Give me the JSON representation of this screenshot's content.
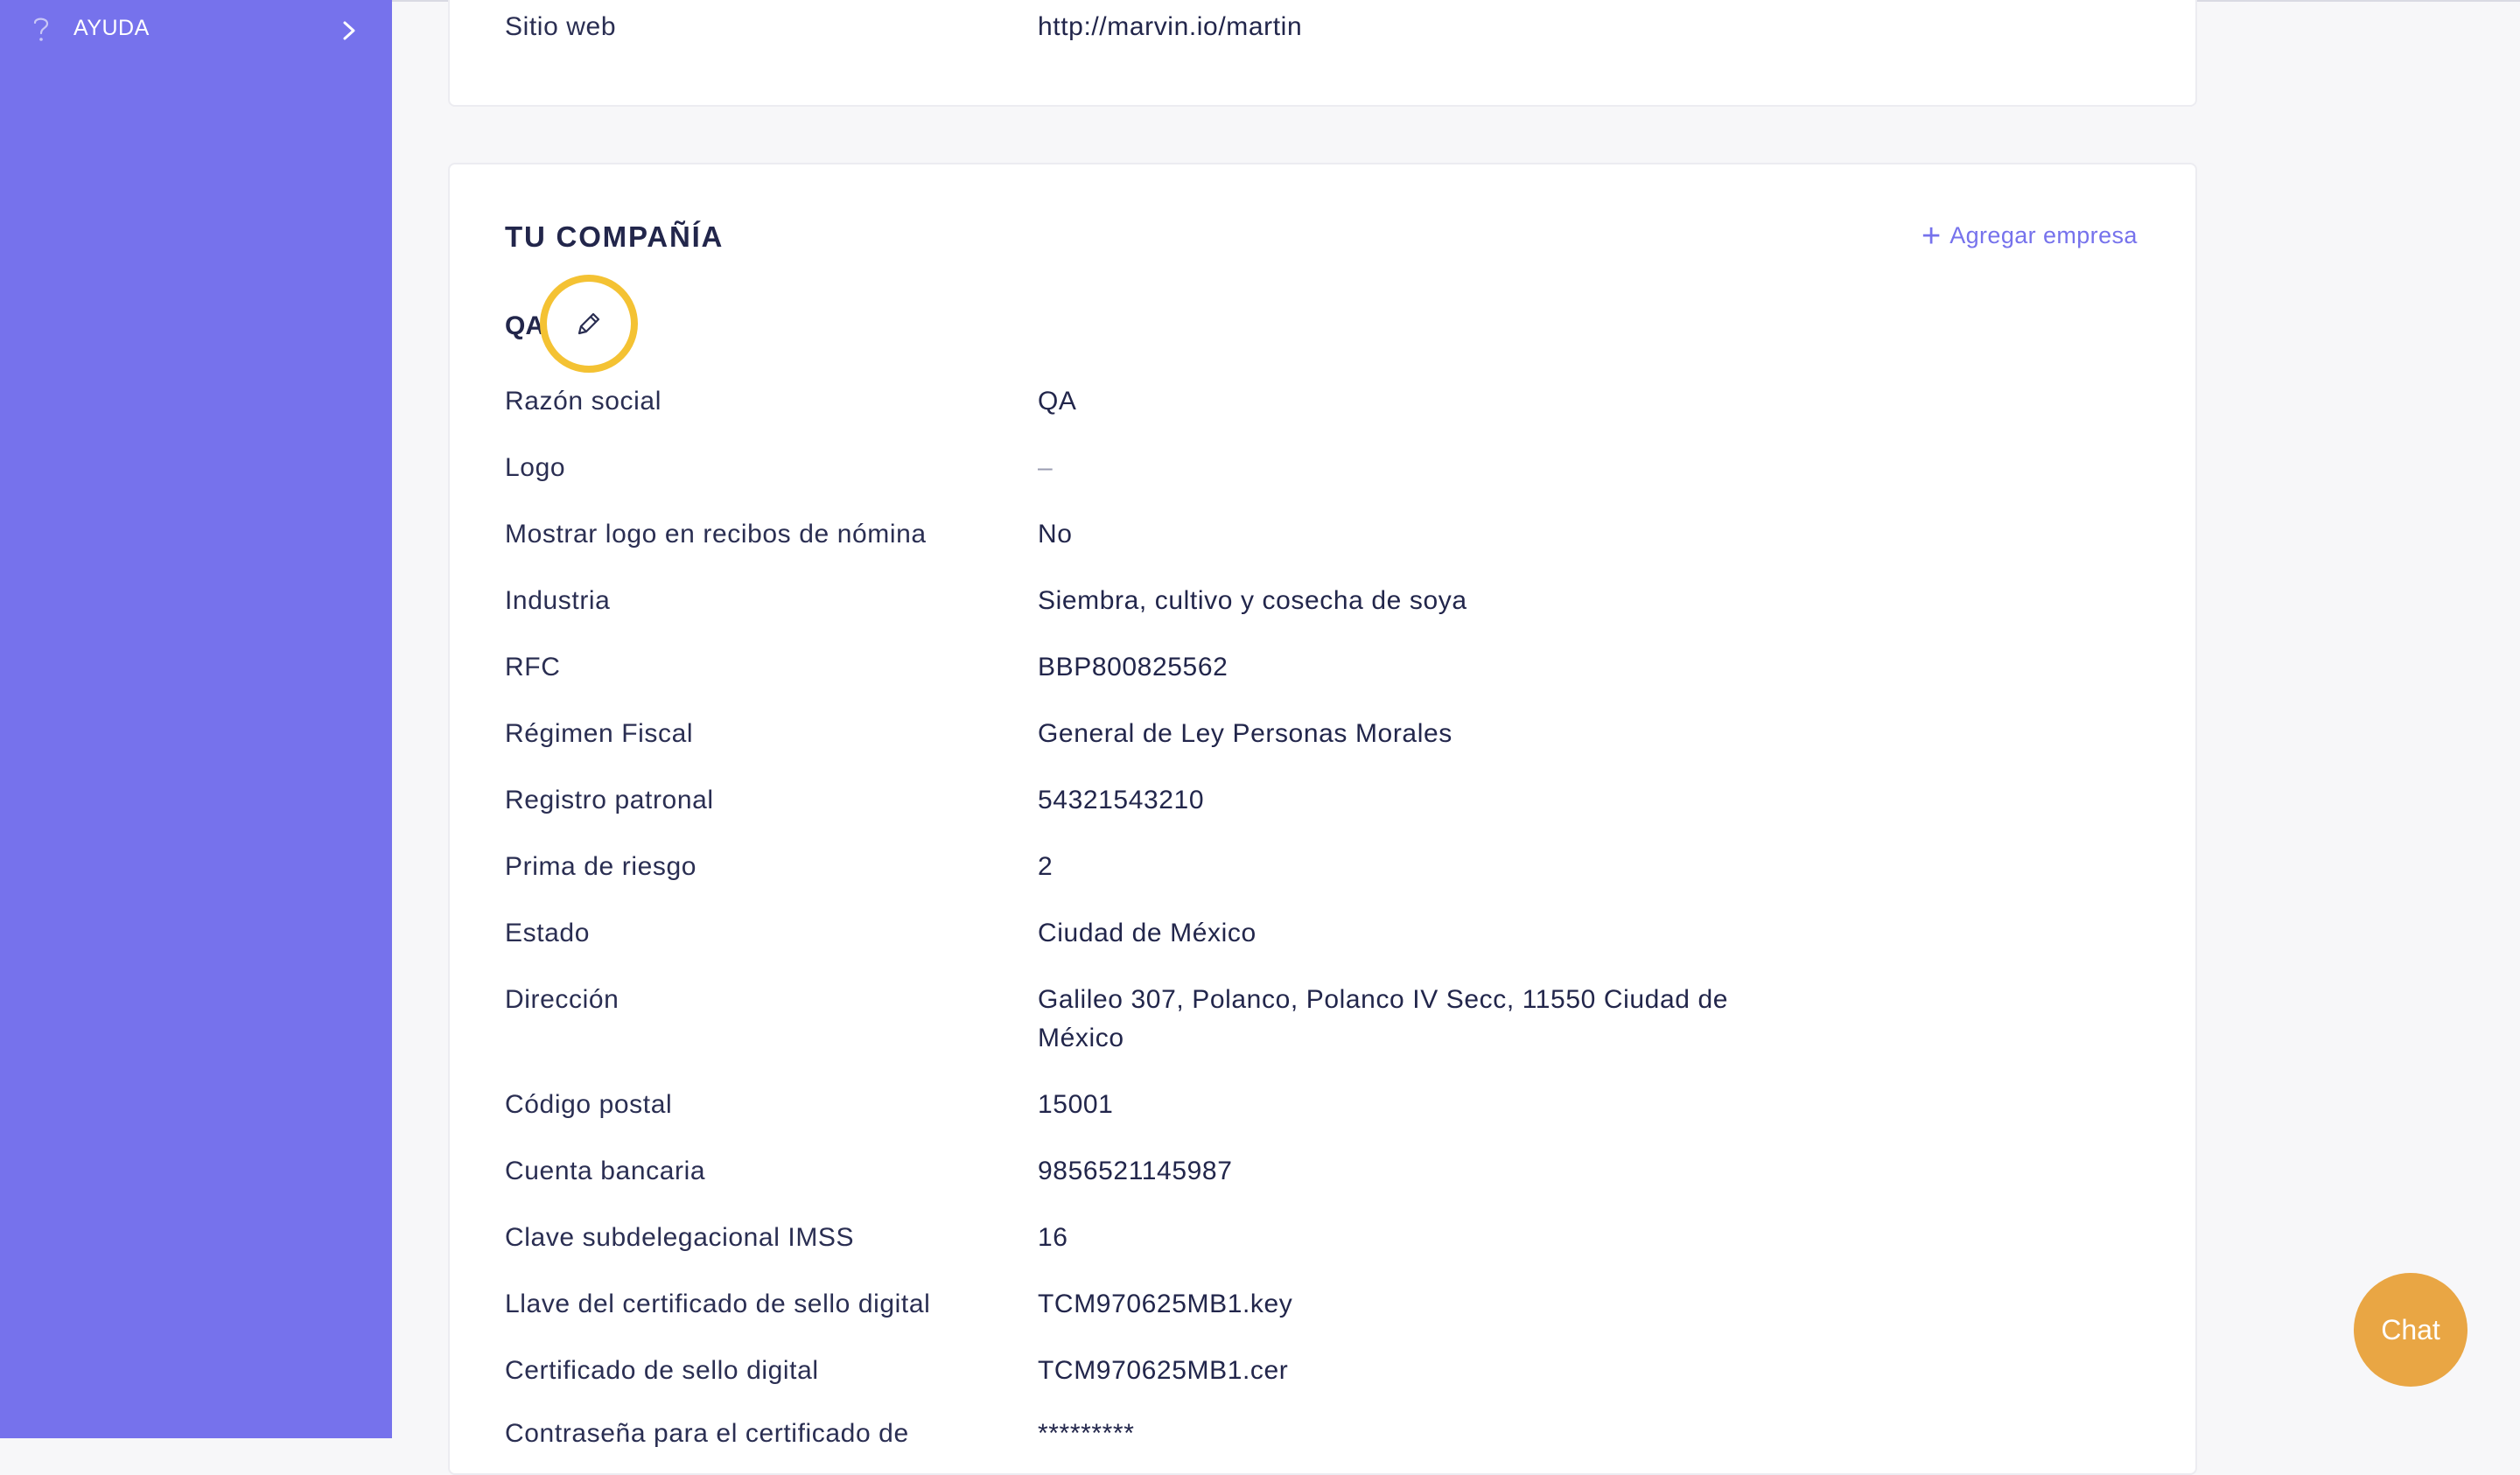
{
  "sidebar": {
    "help_label": "AYUDA"
  },
  "top_card": {
    "website_label": "Sitio web",
    "website_value": "http://marvin.io/martin"
  },
  "company": {
    "section_title": "TU COMPAÑÍA",
    "add_company_label": "Agregar empresa",
    "name": "QA",
    "rows": [
      {
        "label": "Razón social",
        "value": "QA"
      },
      {
        "label": "Logo",
        "value": "–"
      },
      {
        "label": "Mostrar logo en recibos de nómina",
        "value": "No"
      },
      {
        "label": "Industria",
        "value": "Siembra, cultivo y cosecha de soya"
      },
      {
        "label": "RFC",
        "value": "BBP800825562"
      },
      {
        "label": "Régimen Fiscal",
        "value": "General de Ley Personas Morales"
      },
      {
        "label": "Registro patronal",
        "value": "54321543210"
      },
      {
        "label": "Prima de riesgo",
        "value": "2"
      },
      {
        "label": "Estado",
        "value": "Ciudad de México"
      },
      {
        "label": "Dirección",
        "value": "Galileo 307, Polanco, Polanco IV Secc, 11550 Ciudad de México"
      },
      {
        "label": "Código postal",
        "value": "15001"
      },
      {
        "label": "Cuenta bancaria",
        "value": "9856521145987"
      },
      {
        "label": "Clave subdelegacional IMSS",
        "value": "16"
      },
      {
        "label": "Llave del certificado de sello digital",
        "value": "TCM970625MB1.key"
      },
      {
        "label": "Certificado de sello digital",
        "value": "TCM970625MB1.cer"
      },
      {
        "label": "Contraseña para el certificado de",
        "value": "*********"
      }
    ]
  },
  "chat": {
    "label": "Chat"
  },
  "colors": {
    "sidebar": "#7672ec",
    "accent": "#7672ec",
    "highlight_ring": "#f4c233",
    "chat_button": "#e9a644"
  }
}
